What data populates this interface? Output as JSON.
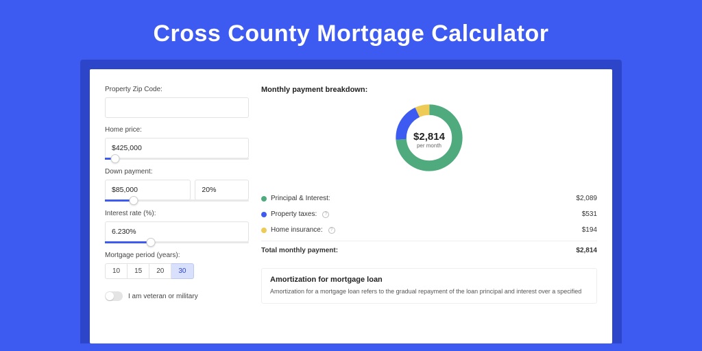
{
  "page_title": "Cross County Mortgage Calculator",
  "form": {
    "zip_label": "Property Zip Code:",
    "zip_value": "",
    "home_price_label": "Home price:",
    "home_price_value": "$425,000",
    "home_price_slider_pct": 7,
    "down_payment_label": "Down payment:",
    "down_payment_value": "$85,000",
    "down_payment_pct_value": "20%",
    "down_payment_slider_pct": 20,
    "interest_label": "Interest rate (%):",
    "interest_value": "6.230%",
    "interest_slider_pct": 32,
    "period_label": "Mortgage period (years):",
    "period_options": [
      "10",
      "15",
      "20",
      "30"
    ],
    "period_selected": "30",
    "veteran_label": "I am veteran or military"
  },
  "breakdown": {
    "title": "Monthly payment breakdown:",
    "center_value": "$2,814",
    "center_sub": "per month",
    "items": [
      {
        "label": "Principal & Interest:",
        "value": "$2,089",
        "color": "#4fab7d",
        "pct": 74,
        "info": false
      },
      {
        "label": "Property taxes:",
        "value": "$531",
        "color": "#3d5af1",
        "pct": 19,
        "info": true
      },
      {
        "label": "Home insurance:",
        "value": "$194",
        "color": "#eeca56",
        "pct": 7,
        "info": true
      }
    ],
    "total_label": "Total monthly payment:",
    "total_value": "$2,814"
  },
  "amortization": {
    "title": "Amortization for mortgage loan",
    "text": "Amortization for a mortgage loan refers to the gradual repayment of the loan principal and interest over a specified"
  },
  "chart_data": {
    "type": "pie",
    "title": "Monthly payment breakdown",
    "series": [
      {
        "name": "Principal & Interest",
        "value": 2089
      },
      {
        "name": "Property taxes",
        "value": 531
      },
      {
        "name": "Home insurance",
        "value": 194
      }
    ],
    "total": 2814,
    "unit": "USD per month"
  }
}
